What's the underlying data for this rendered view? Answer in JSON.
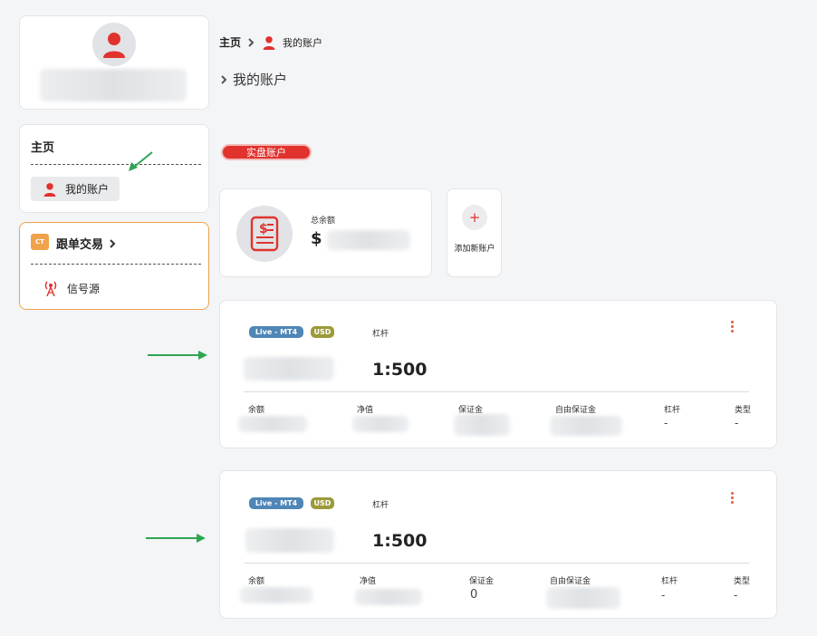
{
  "sidebar": {
    "menu_title": "主页",
    "menu_item": "我的账户",
    "copy_trade": {
      "icon_text": "CT",
      "title": "跟单交易",
      "item": "信号源"
    }
  },
  "breadcrumb": {
    "home": "主页",
    "separator": ">",
    "current": "我的账户"
  },
  "page": {
    "title": "我的账户",
    "title_prefix": ">"
  },
  "live_tab": "实盘账户",
  "balance": {
    "label": "总余额",
    "currency": "$"
  },
  "add_account": {
    "plus": "+",
    "label": "添加新账户"
  },
  "accounts": [
    {
      "platform": "Live - MT4",
      "currency": "USD",
      "leverage_label": "杠杆",
      "leverage": "1:500",
      "cols": [
        "余额",
        "净值",
        "保证金",
        "自由保证金",
        "杠杆",
        "类型"
      ],
      "margin": "",
      "leverage_val": "-",
      "type_val": "-"
    },
    {
      "platform": "Live - MT4",
      "currency": "USD",
      "leverage_label": "杠杆",
      "leverage": "1:500",
      "cols": [
        "余额",
        "净值",
        "保证金",
        "自由保证金",
        "杠杆",
        "类型"
      ],
      "margin": "0",
      "leverage_val": "-",
      "type_val": "-"
    }
  ],
  "colors": {
    "accent_red": "#e1322e",
    "badge_blue": "#4f86b6",
    "badge_olive": "#9c9a3a",
    "copy_trade_border": "#f0a24a",
    "annotation_green": "#2fa552"
  }
}
